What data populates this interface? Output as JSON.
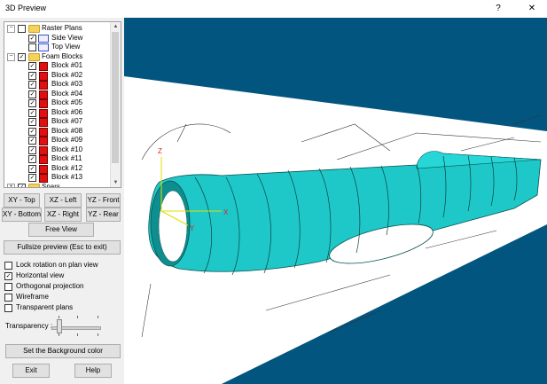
{
  "window": {
    "title": "3D Preview",
    "help_btn": "?",
    "close_btn": "✕"
  },
  "tree": {
    "groups": [
      {
        "label": "Raster Plans",
        "expander": "−",
        "checked": false,
        "items": [
          {
            "label": "Side View",
            "checked": true
          },
          {
            "label": "Top View",
            "checked": false
          }
        ]
      },
      {
        "label": "Foam Blocks",
        "expander": "−",
        "checked": true,
        "items": [
          {
            "label": "Block #01",
            "checked": true
          },
          {
            "label": "Block #02",
            "checked": true
          },
          {
            "label": "Block #03",
            "checked": true
          },
          {
            "label": "Block #04",
            "checked": true
          },
          {
            "label": "Block #05",
            "checked": true
          },
          {
            "label": "Block #06",
            "checked": true
          },
          {
            "label": "Block #07",
            "checked": true
          },
          {
            "label": "Block #08",
            "checked": true
          },
          {
            "label": "Block #09",
            "checked": true
          },
          {
            "label": "Block #10",
            "checked": true
          },
          {
            "label": "Block #11",
            "checked": true
          },
          {
            "label": "Block #12",
            "checked": true
          },
          {
            "label": "Block #13",
            "checked": true
          }
        ]
      },
      {
        "label": "Spars",
        "expander": "+",
        "checked": true,
        "items": []
      }
    ]
  },
  "view_buttons": {
    "xy_top": "XY - Top",
    "xz_left": "XZ - Left",
    "yz_front": "YZ - Front",
    "xy_bottom": "XY - Bottom",
    "xz_right": "XZ - Right",
    "yz_rear": "YZ - Rear",
    "free_view": "Free View",
    "fullsize": "Fullsize preview (Esc to exit)"
  },
  "options": [
    {
      "label": "Lock rotation on plan view",
      "checked": false
    },
    {
      "label": "Horizontal view",
      "checked": true
    },
    {
      "label": "Orthogonal projection",
      "checked": false
    },
    {
      "label": "Wireframe",
      "checked": false
    },
    {
      "label": "Transparent plans",
      "checked": false
    }
  ],
  "transparency": {
    "label": "Transparency :",
    "value": 0.15
  },
  "bottom_buttons": {
    "background": "Set the Background color",
    "exit": "Exit",
    "help": "Help"
  },
  "viewport": {
    "background_color": "#01557f",
    "plan_color": "#ffffff",
    "fuselage_color": "#1fc8c8",
    "axis_labels": {
      "x": "X",
      "y": "Y",
      "z": "Z"
    }
  }
}
